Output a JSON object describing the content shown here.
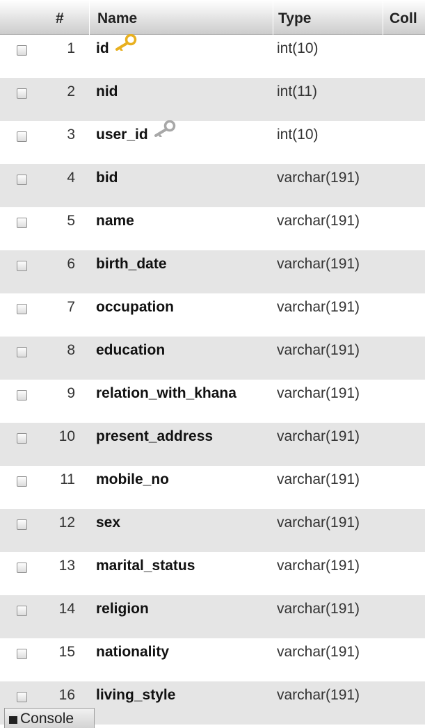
{
  "table": {
    "headers": {
      "num": "#",
      "name": "Name",
      "type": "Type",
      "collation": "Coll"
    },
    "rows": [
      {
        "num": "1",
        "name": "id",
        "type": "int(10)",
        "key": "primary"
      },
      {
        "num": "2",
        "name": "nid",
        "type": "int(11)",
        "key": ""
      },
      {
        "num": "3",
        "name": "user_id",
        "type": "int(10)",
        "key": "index"
      },
      {
        "num": "4",
        "name": "bid",
        "type": "varchar(191)",
        "key": ""
      },
      {
        "num": "5",
        "name": "name",
        "type": "varchar(191)",
        "key": ""
      },
      {
        "num": "6",
        "name": "birth_date",
        "type": "varchar(191)",
        "key": ""
      },
      {
        "num": "7",
        "name": "occupation",
        "type": "varchar(191)",
        "key": ""
      },
      {
        "num": "8",
        "name": "education",
        "type": "varchar(191)",
        "key": ""
      },
      {
        "num": "9",
        "name": "relation_with_khana",
        "type": "varchar(191)",
        "key": ""
      },
      {
        "num": "10",
        "name": "present_address",
        "type": "varchar(191)",
        "key": ""
      },
      {
        "num": "11",
        "name": "mobile_no",
        "type": "varchar(191)",
        "key": ""
      },
      {
        "num": "12",
        "name": "sex",
        "type": "varchar(191)",
        "key": ""
      },
      {
        "num": "13",
        "name": "marital_status",
        "type": "varchar(191)",
        "key": ""
      },
      {
        "num": "14",
        "name": "religion",
        "type": "varchar(191)",
        "key": ""
      },
      {
        "num": "15",
        "name": "nationality",
        "type": "varchar(191)",
        "key": ""
      },
      {
        "num": "16",
        "name": "living_style",
        "type": "varchar(191)",
        "key": ""
      }
    ]
  },
  "console": {
    "label": "Console"
  },
  "icons": {
    "primary_key": "primary-key-icon",
    "index_key": "index-key-icon",
    "console": "console-icon"
  },
  "colors": {
    "primary_key": "#e8b020",
    "index_key": "#a8a8a8",
    "row_stripe": "#e5e5e5"
  }
}
